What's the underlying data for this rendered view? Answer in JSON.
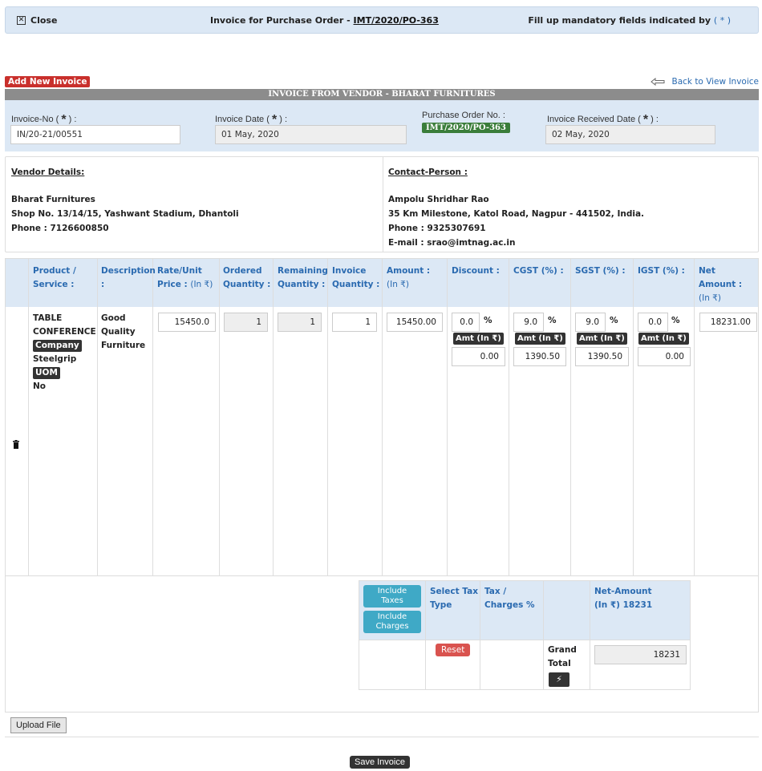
{
  "topbar": {
    "close_label": "Close",
    "title_prefix": "Invoice for Purchase Order - ",
    "po_link": "IMT/2020/PO-363",
    "mandatory_text": "Fill up mandatory fields indicated by ",
    "mandatory_marker": "( * )"
  },
  "add_new_label": "Add New Invoice",
  "back_label": "Back to View Invoice",
  "section_title": "INVOICE FROM VENDOR - BHARAT FURNITURES",
  "meta": {
    "invoice_no_label": "Invoice-No (",
    "invoice_no_value": "IN/20-21/00551",
    "invoice_date_label": "Invoice Date (",
    "invoice_date_value": "01 May, 2020",
    "po_label": "Purchase Order No. :",
    "po_value": "IMT/2020/PO-363",
    "received_label": "Invoice Received Date (",
    "received_value": "02 May, 2020",
    "star": "*",
    "close_paren": " ) :"
  },
  "vendor": {
    "heading": "Vendor Details:",
    "name": "Bharat Furnitures",
    "address": "Shop No. 13/14/15, Yashwant Stadium, Dhantoli",
    "phone": "Phone : 7126600850"
  },
  "contact": {
    "heading": "Contact-Person :",
    "name": "Ampolu Shridhar Rao",
    "address": "35 Km Milestone, Katol Road, Nagpur - 441502, India.",
    "phone": "Phone : 9325307691",
    "email": "E-mail : srao@imtnag.ac.in"
  },
  "columns": {
    "product": [
      "Product /",
      "Service :"
    ],
    "description": [
      "Description",
      ":"
    ],
    "rate": [
      "Rate/Unit",
      "Price :",
      "(In ₹)"
    ],
    "ordered": [
      "Ordered",
      "Quantity :"
    ],
    "remaining": [
      "Remaining",
      "Quantity :"
    ],
    "invoice_qty": [
      "Invoice",
      "Quantity :"
    ],
    "amount": [
      "Amount :",
      "(In ₹)"
    ],
    "discount": "Discount :",
    "cgst": "CGST (%) :",
    "sgst": "SGST (%) :",
    "igst": "IGST (%) :",
    "net": [
      "Net",
      "Amount :",
      "(In ₹)"
    ]
  },
  "row": {
    "product_name_1": "TABLE",
    "product_name_2": "CONFERENCE",
    "company_tag": "Company",
    "company_value": "Steelgrip",
    "uom_tag": "UOM",
    "uom_value": "No",
    "description_1": "Good",
    "description_2": "Quality",
    "description_3": "Furniture",
    "rate": "15450.0",
    "ordered": "1",
    "remaining": "1",
    "invoice_qty": "1",
    "amount": "15450.00",
    "discount_pct": "0.0",
    "discount_amt": "0.00",
    "cgst_pct": "9.0",
    "cgst_amt": "1390.50",
    "sgst_pct": "9.0",
    "sgst_amt": "1390.50",
    "igst_pct": "0.0",
    "igst_amt": "0.00",
    "net": "18231.00",
    "pct_symbol": "%",
    "amt_tag": "Amt (In ₹)"
  },
  "summary": {
    "include_taxes": [
      "Include",
      "Taxes"
    ],
    "include_charges": [
      "Include",
      "Charges"
    ],
    "select_tax": [
      "Select Tax",
      "Type"
    ],
    "tax_charges": [
      "Tax /",
      "Charges %"
    ],
    "net_amount_label": "Net-Amount",
    "net_amount_value": "(In ₹)  18231",
    "reset_label": "Reset",
    "grand_total": [
      "Grand",
      "Total"
    ],
    "grand_total_value": "18231",
    "refresh_symbol": "⚡"
  },
  "upload_label": "Upload File",
  "save_label": "Save Invoice"
}
